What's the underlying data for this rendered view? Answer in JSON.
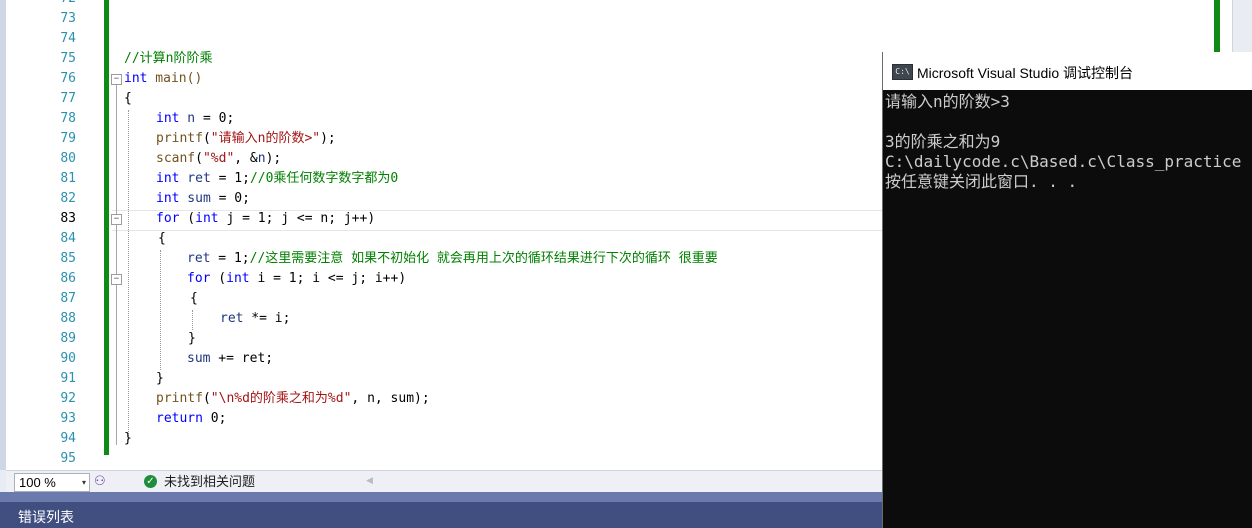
{
  "editor": {
    "line_numbers": [
      "73",
      "74",
      "75",
      "76",
      "77",
      "78",
      "79",
      "80",
      "81",
      "82",
      "83",
      "84",
      "85",
      "86",
      "87",
      "88",
      "89",
      "90",
      "91",
      "92",
      "93",
      "94",
      "95"
    ],
    "code": {
      "l75_comment": "//计算n阶阶乘",
      "l76_kw": "int",
      "l76_rest": " main()",
      "l77": "{",
      "l78_kw": "int",
      "l78_var": " n",
      "l78_rest": " = 0;",
      "l79_fn": "printf",
      "l79_open": "(",
      "l79_str": "\"请输入n的阶数>\"",
      "l79_close": ");",
      "l80_fn": "scanf",
      "l80_open": "(",
      "l80_str": "\"%d\"",
      "l80_rest": ", &",
      "l80_var": "n",
      "l80_close": ");",
      "l81_kw": "int",
      "l81_var": " ret",
      "l81_rest": " = 1;",
      "l81_comment": "//0乘任何数字数字都为0",
      "l82_kw": "int",
      "l82_var": " sum",
      "l82_rest": " = 0;",
      "l83_kw": "for",
      "l83_open": " (",
      "l83_kw2": "int",
      "l83_rest": " j = 1; j <= n; j++)",
      "l84": "{",
      "l85_var": "ret",
      "l85_rest": " = 1;",
      "l85_comment": "//这里需要注意 如果不初始化 就会再用上次的循环结果进行下次的循环 很重要",
      "l86_kw": "for",
      "l86_open": " (",
      "l86_kw2": "int",
      "l86_rest": " i = 1; i <= j; i++)",
      "l87": "{",
      "l88_var": "ret",
      "l88_rest": " *= i;",
      "l89": "}",
      "l90_var": "sum",
      "l90_rest": " += ret;",
      "l91": "}",
      "l92_fn": "printf",
      "l92_open": "(",
      "l92_str": "\"\\n%d的阶乘之和为%d\"",
      "l92_rest": ", n, sum);",
      "l93_kw": "return",
      "l93_rest": " 0;",
      "l94": "}"
    }
  },
  "status": {
    "zoom": "100 %",
    "zoom_arrow": "▾",
    "health_icon_glyph": "⚇",
    "ok_glyph": "✓",
    "issues": "未找到相关问题",
    "scroll_left_glyph": "◀"
  },
  "error_list": {
    "title": "错误列表"
  },
  "console": {
    "icon_text": "C:\\",
    "title": "Microsoft Visual Studio 调试控制台",
    "lines": [
      "请输入n的阶数>3",
      "",
      "3的阶乘之和为9",
      "C:\\dailycode.c\\Based.c\\Class_practice",
      "按任意键关闭此窗口. . ."
    ]
  },
  "colors": {
    "keyword": "#0000ff",
    "string": "#a31515",
    "comment": "#008000",
    "line_number": "#2b91af",
    "change_bar": "#0e8a16",
    "console_bg": "#0c0c0c",
    "error_bar": "#404f80"
  }
}
